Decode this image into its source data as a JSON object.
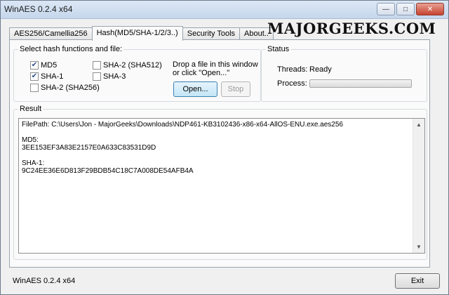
{
  "window": {
    "title": "WinAES 0.2.4 x64",
    "controls": {
      "minimize": "—",
      "maximize": "□",
      "close": "✕"
    }
  },
  "tabs": [
    {
      "label": "AES256/Camellia256"
    },
    {
      "label": "Hash(MD5/SHA-1/2/3..)"
    },
    {
      "label": "Security Tools"
    },
    {
      "label": "About.."
    }
  ],
  "brand": "MAJORGEEKS.COM",
  "hash_group": {
    "label": "Select hash functions and file:",
    "options": [
      {
        "label": "MD5",
        "checked": true
      },
      {
        "label": "SHA-1",
        "checked": true
      },
      {
        "label": "SHA-2 (SHA256)",
        "checked": false
      },
      {
        "label": "SHA-2 (SHA512)",
        "checked": false
      },
      {
        "label": "SHA-3",
        "checked": false
      }
    ],
    "drop_line1": "Drop a file in this window",
    "drop_line2": "or click \"Open...\"",
    "open_label": "Open...",
    "stop_label": "Stop"
  },
  "status_group": {
    "label": "Status",
    "threads_label": "Threads:",
    "threads_value": "Ready",
    "process_label": "Process:",
    "progress_fraction": 0
  },
  "result": {
    "label": "Result",
    "text": "FilePath: C:\\Users\\Jon - MajorGeeks\\Downloads\\NDP461-KB3102436-x86-x64-AllOS-ENU.exe.aes256\n\nMD5:\n3EE153EF3A83E2157E0A633C83531D9D\n\nSHA-1:\n9C24EE36E6D813F29BDB54C18C7A008DE54AFB4A"
  },
  "footer": {
    "status_text": "WinAES 0.2.4 x64",
    "exit_label": "Exit"
  },
  "colors": {
    "progress_fill": "#3fbf3f"
  }
}
